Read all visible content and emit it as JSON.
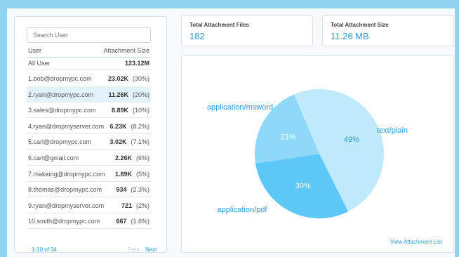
{
  "search": {
    "placeholder": "Search User"
  },
  "table": {
    "columns": [
      "User",
      "Attachment Size"
    ],
    "all_row": {
      "name": "All User",
      "size": "123.12M"
    },
    "rows": [
      {
        "name": "1.bob@dropmypc.com",
        "size": "23.02K",
        "pct": "(30%)"
      },
      {
        "name": "2.ryan@dropmypc.com",
        "size": "11.26K",
        "pct": "(20%)"
      },
      {
        "name": "3.sales@dropmypc.com",
        "size": "8.89K",
        "pct": "(10%)"
      },
      {
        "name": "4.ryan@dropmyserver.com",
        "size": "6.23K",
        "pct": "(8.2%)"
      },
      {
        "name": "5.carl@dropmypc.com",
        "size": "3.02K",
        "pct": "(7.1%)"
      },
      {
        "name": "6.carl@gmail.com",
        "size": "2.26K",
        "pct": "(6%)"
      },
      {
        "name": "7.makeing@dropmypc.com",
        "size": "1.89K",
        "pct": "(5%)"
      },
      {
        "name": "8.thomas@dropmypc.com",
        "size": "934",
        "pct": "(2.3%)"
      },
      {
        "name": "9.ryan@dropmyserver.com",
        "size": "721",
        "pct": "(2%)"
      },
      {
        "name": "10.smith@dropmypc.com",
        "size": "667",
        "pct": "(1.6%)"
      }
    ],
    "selected_index": 1
  },
  "pagination": {
    "info": "1-10 of 34",
    "prev": "Prev",
    "next": "Next"
  },
  "stats": {
    "files_label": "Total Attachment Files",
    "files_value": "182",
    "size_label": "Total Attachment Size",
    "size_value": "11.26 MB"
  },
  "chart_data": {
    "type": "pie",
    "slices": [
      {
        "label": "text/plain",
        "value": 49,
        "display": "49%",
        "color": "#bfe9fd"
      },
      {
        "label": "application/pdf",
        "value": 30,
        "display": "30%",
        "color": "#5ec8f8"
      },
      {
        "label": "application/msword",
        "value": 21,
        "display": "21%",
        "color": "#8fd8fa"
      }
    ]
  },
  "view_link": "View Attachment List",
  "colors": {
    "accent": "#2f9bd6",
    "frame": "#8fd3f0",
    "selected_row": "#e3f3fc"
  }
}
